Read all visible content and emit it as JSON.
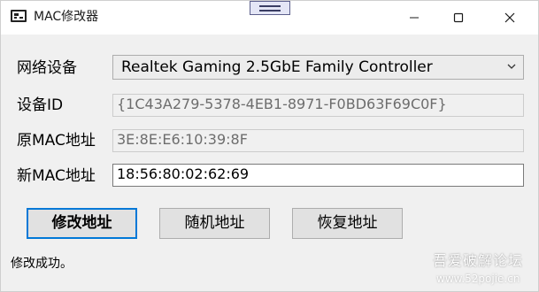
{
  "window": {
    "title": "MAC修改器"
  },
  "icons": {
    "app": "mac-editor-app-icon",
    "drag": "drag-handle-icon",
    "minimize": "minimize-icon",
    "maximize": "maximize-icon",
    "close": "close-icon",
    "dropdown": "chevron-down-icon"
  },
  "form": {
    "device_label": "网络设备",
    "device_value": "Realtek Gaming 2.5GbE Family Controller",
    "device_id_label": "设备ID",
    "device_id_value": "{1C43A279-5378-4EB1-8971-F0BD63F69C0F}",
    "original_mac_label": "原MAC地址",
    "original_mac_value": "3E:8E:E6:10:39:8F",
    "new_mac_label": "新MAC地址",
    "new_mac_value": "18:56:80:02:62:69"
  },
  "buttons": {
    "modify": "修改地址",
    "random": "随机地址",
    "restore": "恢复地址"
  },
  "status": {
    "text": "修改成功。"
  },
  "watermark": {
    "name": "吾爱破解论坛",
    "url": "www.52pojie.cn"
  },
  "colors": {
    "focus_accent": "#0078d7",
    "window_bg": "#f0f0f0",
    "titlebar_bg": "#ffffff"
  }
}
